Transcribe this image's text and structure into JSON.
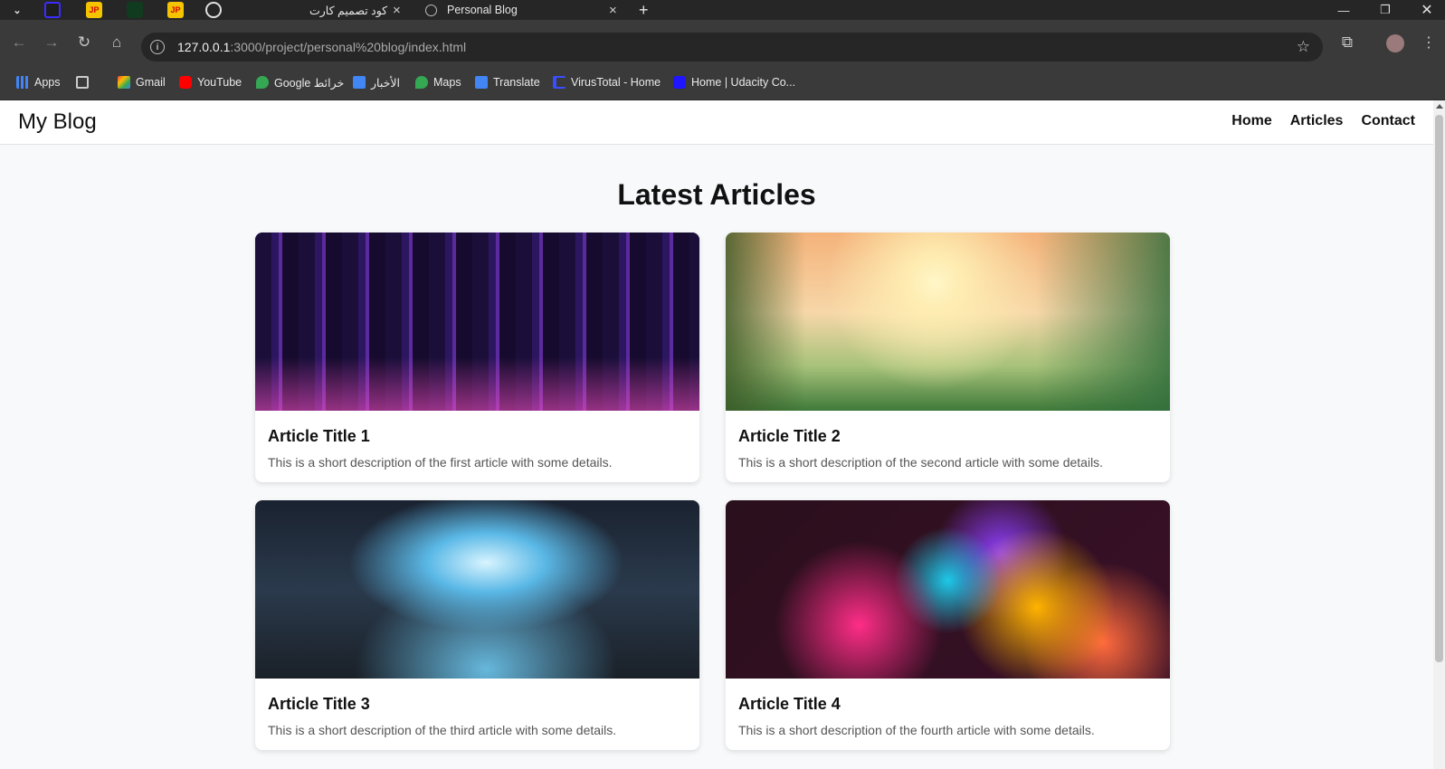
{
  "browser": {
    "tabs": [
      {
        "title": "كود تصميم كارت",
        "active": false
      },
      {
        "title": "Personal Blog",
        "active": true
      }
    ],
    "pinned_icons": [
      "tab-search-icon",
      "udacity-icon",
      "jp-icon",
      "image-icon",
      "jp-icon",
      "openai-icon"
    ],
    "jp_label": "JP",
    "new_tab_label": "+",
    "close_label": "×",
    "url_host": "127.0.0.1",
    "url_rest": ":3000/project/personal%20blog/index.html",
    "bookmarks": [
      {
        "label": "Apps",
        "icon": "apps-grid-icon",
        "color": "#4285f4"
      },
      {
        "label": "",
        "icon": "grid-icon",
        "color": "#cccccc"
      },
      {
        "label": "Gmail",
        "icon": "gmail-icon",
        "color": "#ea4335"
      },
      {
        "label": "YouTube",
        "icon": "youtube-icon",
        "color": "#ff0000"
      },
      {
        "label": "Google خرائط",
        "icon": "maps-icon",
        "color": "#34a853"
      },
      {
        "label": "الأخبار",
        "icon": "news-icon",
        "color": "#4285f4"
      },
      {
        "label": "Maps",
        "icon": "maps-icon",
        "color": "#34a853"
      },
      {
        "label": "Translate",
        "icon": "translate-icon",
        "color": "#4285f4"
      },
      {
        "label": "VirusTotal - Home",
        "icon": "virustotal-icon",
        "color": "#394eff"
      },
      {
        "label": "Home | Udacity Co...",
        "icon": "udacity-icon",
        "color": "#2015ff"
      }
    ]
  },
  "site": {
    "logo": "My Blog",
    "nav": [
      "Home",
      "Articles",
      "Contact"
    ],
    "section_title": "Latest Articles",
    "articles": [
      {
        "title": "Article Title 1",
        "description": "This is a short description of the first article with some details.",
        "image": "cyberpunk-city"
      },
      {
        "title": "Article Title 2",
        "description": "This is a short description of the second article with some details.",
        "image": "fantasy-landscape"
      },
      {
        "title": "Article Title 3",
        "description": "This is a short description of the third article with some details.",
        "image": "futuristic-tech-room"
      },
      {
        "title": "Article Title 4",
        "description": "This is a short description of the fourth article with some details.",
        "image": "colorful-abstract"
      }
    ]
  },
  "colors": {
    "chrome_dark": "#262626",
    "chrome_toolbar": "#3a3a3a",
    "page_bg": "#f8f9fa",
    "card_bg": "#ffffff"
  }
}
